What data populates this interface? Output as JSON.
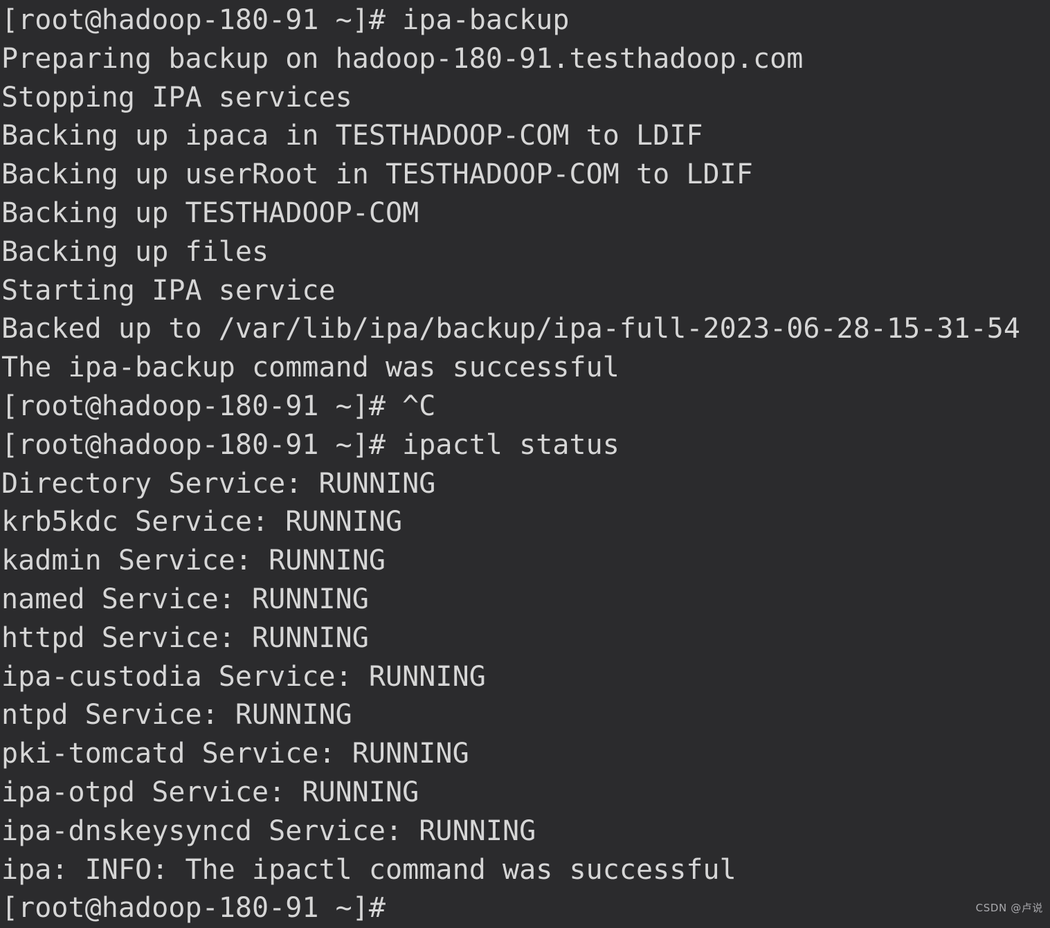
{
  "terminal": {
    "background_color": "#2b2b2d",
    "foreground_color": "#d6d6d6",
    "hostname": "hadoop-180-91",
    "user": "root",
    "prompt": "[root@hadoop-180-91 ~]#",
    "lines": [
      "[root@hadoop-180-91 ~]# ipa-backup",
      "Preparing backup on hadoop-180-91.testhadoop.com",
      "Stopping IPA services",
      "Backing up ipaca in TESTHADOOP-COM to LDIF",
      "Backing up userRoot in TESTHADOOP-COM to LDIF",
      "Backing up TESTHADOOP-COM",
      "Backing up files",
      "Starting IPA service",
      "Backed up to /var/lib/ipa/backup/ipa-full-2023-06-28-15-31-54",
      "The ipa-backup command was successful",
      "[root@hadoop-180-91 ~]# ^C",
      "[root@hadoop-180-91 ~]# ipactl status",
      "Directory Service: RUNNING",
      "krb5kdc Service: RUNNING",
      "kadmin Service: RUNNING",
      "named Service: RUNNING",
      "httpd Service: RUNNING",
      "ipa-custodia Service: RUNNING",
      "ntpd Service: RUNNING",
      "pki-tomcatd Service: RUNNING",
      "ipa-otpd Service: RUNNING",
      "ipa-dnskeysyncd Service: RUNNING",
      "ipa: INFO: The ipactl command was successful",
      "[root@hadoop-180-91 ~]#"
    ],
    "commands": [
      "ipa-backup",
      "^C",
      "ipactl status"
    ],
    "backup_path": "/var/lib/ipa/backup/ipa-full-2023-06-28-15-31-54",
    "realm": "TESTHADOOP-COM",
    "fqdn": "hadoop-180-91.testhadoop.com",
    "services": [
      {
        "name": "Directory",
        "status": "RUNNING"
      },
      {
        "name": "krb5kdc",
        "status": "RUNNING"
      },
      {
        "name": "kadmin",
        "status": "RUNNING"
      },
      {
        "name": "named",
        "status": "RUNNING"
      },
      {
        "name": "httpd",
        "status": "RUNNING"
      },
      {
        "name": "ipa-custodia",
        "status": "RUNNING"
      },
      {
        "name": "ntpd",
        "status": "RUNNING"
      },
      {
        "name": "pki-tomcatd",
        "status": "RUNNING"
      },
      {
        "name": "ipa-otpd",
        "status": "RUNNING"
      },
      {
        "name": "ipa-dnskeysyncd",
        "status": "RUNNING"
      }
    ]
  },
  "watermark": {
    "text": "CSDN @卢说",
    "color": "#a9a9ad"
  }
}
